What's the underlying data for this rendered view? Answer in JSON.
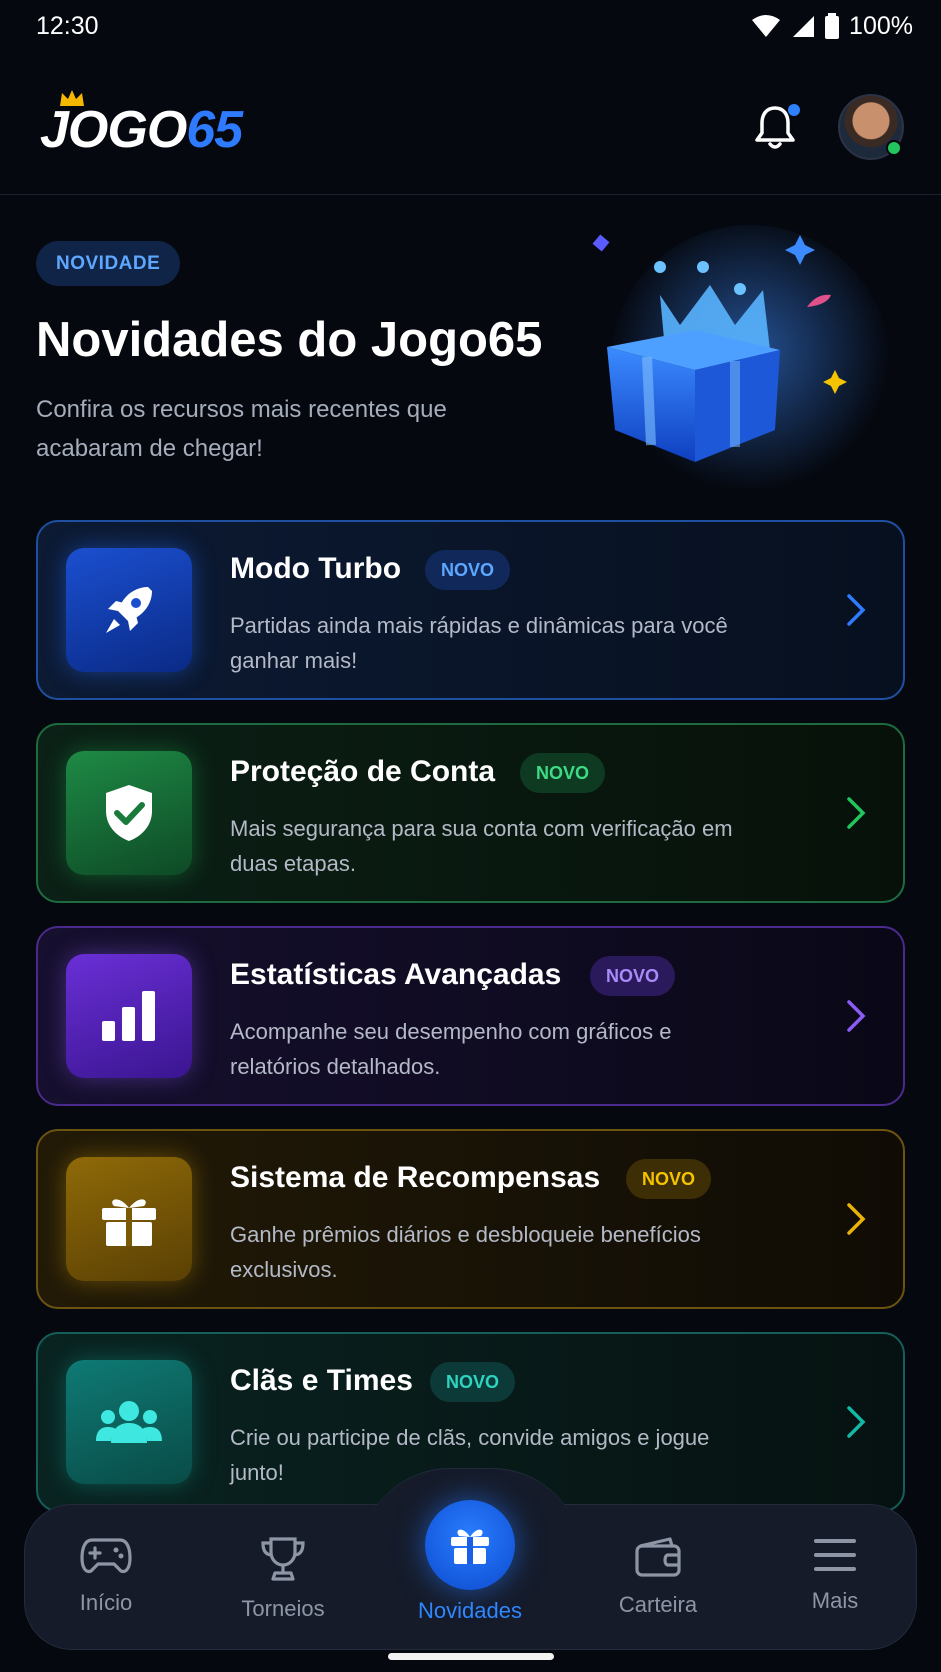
{
  "status_bar": {
    "time": "12:30",
    "battery": "100%"
  },
  "header": {
    "logo_part1": "JOGO",
    "logo_part2": "65"
  },
  "hero": {
    "tag": "NOVIDADE",
    "title": "Novidades do Jogo65",
    "subtitle": "Confira os recursos mais recentes que acabaram de chegar!"
  },
  "features": [
    {
      "title": "Modo Turbo",
      "badge": "NOVO",
      "description": "Partidas ainda mais rápidas e dinâmicas para você ganhar mais!",
      "icon": "rocket-icon",
      "accent": "#2f7bff"
    },
    {
      "title": "Proteção de Conta",
      "badge": "NOVO",
      "description": "Mais segurança para sua conta com verificação em duas etapas.",
      "icon": "shield-check-icon",
      "accent": "#22c55e"
    },
    {
      "title": "Estatísticas Avançadas",
      "badge": "NOVO",
      "description": "Acompanhe seu desempenho com gráficos e relatórios detalhados.",
      "icon": "bar-chart-icon",
      "accent": "#8b5cf6"
    },
    {
      "title": "Sistema de Recompensas",
      "badge": "NOVO",
      "description": "Ganhe prêmios diários e desbloqueie benefícios exclusivos.",
      "icon": "gift-icon",
      "accent": "#eab308"
    },
    {
      "title": "Clãs e Times",
      "badge": "NOVO",
      "description": "Crie ou participe de clãs, convide amigos e jogue junto!",
      "icon": "users-icon",
      "accent": "#14b8a6"
    }
  ],
  "bottom_nav": {
    "items": [
      {
        "label": "Início",
        "icon": "gamepad-icon"
      },
      {
        "label": "Torneios",
        "icon": "trophy-icon"
      },
      {
        "label": "Novidades",
        "icon": "gift-icon",
        "active": true
      },
      {
        "label": "Carteira",
        "icon": "wallet-icon"
      },
      {
        "label": "Mais",
        "icon": "menu-icon"
      }
    ]
  }
}
